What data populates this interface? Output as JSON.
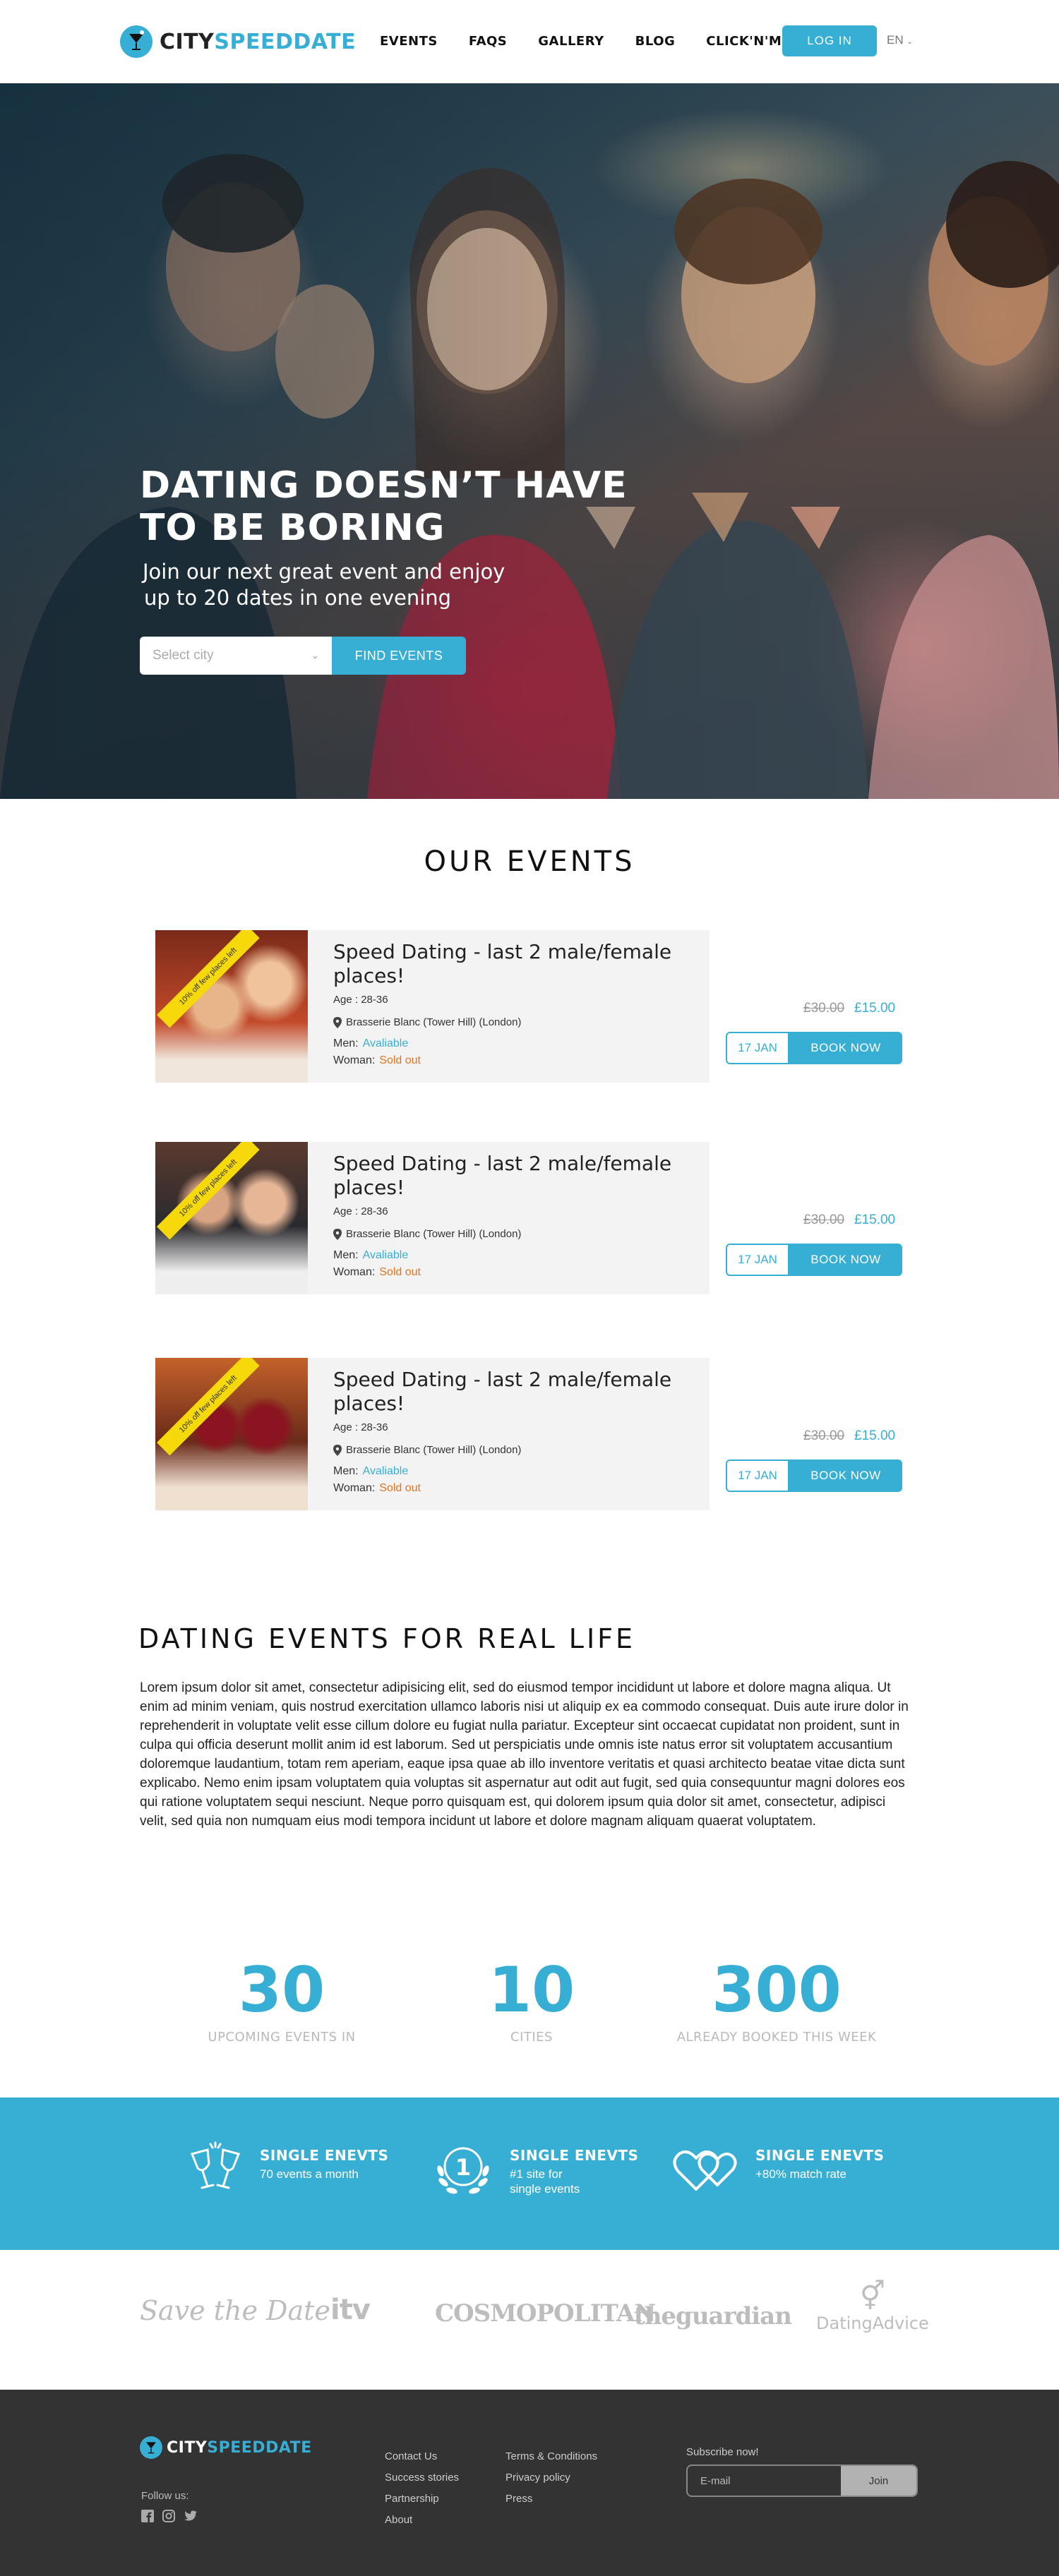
{
  "brand": {
    "name_part1": "CITY",
    "name_part2": "SPEEDDATE",
    "accent": "#37aed3",
    "icon": "cocktail-glass-icon"
  },
  "nav": {
    "items": [
      {
        "label": "EVENTS"
      },
      {
        "label": "FAQS"
      },
      {
        "label": "GALLERY"
      },
      {
        "label": "BLOG"
      },
      {
        "label": "CLICK'N'MEET"
      }
    ]
  },
  "header": {
    "login_label": "LOG IN",
    "language": "EN"
  },
  "hero": {
    "title_line1": "DATING DOESN’T HAVE",
    "title_line2": "TO BE BORING",
    "subtitle_line1": "Join our next great event and enjoy",
    "subtitle_line2": "up to 20 dates in one evening",
    "city_placeholder": "Select city",
    "find_label": "FIND EVENTS"
  },
  "events": {
    "title": "OUR EVENTS",
    "items": [
      {
        "ribbon": "10% off few places left",
        "title": "Speed Dating - last 2 male/female places!",
        "age": "Age : 28-36",
        "venue": "Brasserie Blanc (Tower Hill) (London)",
        "men_label": "Men:",
        "men_status": "Avaliable",
        "women_label": "Woman:",
        "women_status": "Sold out",
        "old_price": "£30.00",
        "new_price": "£15.00",
        "date": "17 JAN",
        "book_label": "BOOK NOW"
      },
      {
        "ribbon": "10% off few places left",
        "title": "Speed Dating - last 2 male/female places!",
        "age": "Age : 28-36",
        "venue": "Brasserie Blanc (Tower Hill) (London)",
        "men_label": "Men:",
        "men_status": "Avaliable",
        "women_label": "Woman:",
        "women_status": "Sold out",
        "old_price": "£30.00",
        "new_price": "£15.00",
        "date": "17 JAN",
        "book_label": "BOOK NOW"
      },
      {
        "ribbon": "10% off few places left",
        "title": "Speed Dating - last 2 male/female places!",
        "age": "Age : 28-36",
        "venue": "Brasserie Blanc (Tower Hill) (London)",
        "men_label": "Men:",
        "men_status": "Avaliable",
        "women_label": "Woman:",
        "women_status": "Sold out",
        "old_price": "£30.00",
        "new_price": "£15.00",
        "date": "17 JAN",
        "book_label": "BOOK NOW"
      }
    ]
  },
  "real_life": {
    "title": "DATING EVENTS FOR REAL LIFE",
    "text": "Lorem ipsum dolor sit amet, consectetur adipisicing elit, sed do eiusmod tempor incididunt ut labore et dolore magna aliqua. Ut enim ad minim veniam, quis nostrud exercitation ullamco laboris nisi ut aliquip ex ea commodo consequat. Duis aute irure dolor in reprehenderit in voluptate velit esse cillum dolore eu fugiat nulla pariatur. Excepteur sint occaecat cupidatat non proident, sunt in culpa qui officia deserunt mollit anim id est laborum. Sed ut perspiciatis unde omnis iste natus error sit voluptatem accusantium doloremque laudantium, totam rem aperiam, eaque ipsa quae ab illo inventore veritatis et quasi architecto beatae vitae dicta sunt explicabo. Nemo enim ipsam voluptatem quia voluptas sit aspernatur aut odit aut fugit, sed quia consequuntur magni dolores eos qui ratione voluptatem sequi nesciunt. Neque porro quisquam est, qui dolorem ipsum quia dolor sit amet, consectetur, adipisci velit, sed quia non numquam eius modi tempora incidunt ut labore et dolore magnam aliquam quaerat voluptatem."
  },
  "stats": [
    {
      "number": "30",
      "label": "UPCOMING EVENTS IN"
    },
    {
      "number": "10",
      "label": "CITIES"
    },
    {
      "number": "300",
      "label": "ALREADY BOOKED THIS WEEK"
    }
  ],
  "features": [
    {
      "icon": "toasting-glasses-icon",
      "title": "SINGLE ENEVTS",
      "line1": "70 events a month",
      "line2": ""
    },
    {
      "icon": "number-one-medal-icon",
      "title": "SINGLE ENEVTS",
      "line1": "#1 site for",
      "line2": "single events"
    },
    {
      "icon": "hearts-icon",
      "title": "SINGLE ENEVTS",
      "line1": "+80% match rate",
      "line2": ""
    }
  ],
  "press": [
    "Save the Date",
    "itv",
    "COSMOPOLITAN",
    "theguardian",
    "DatingAdvice"
  ],
  "footer": {
    "follow_label": "Follow us:",
    "social_icons": [
      "facebook-icon",
      "instagram-icon",
      "twitter-icon"
    ],
    "col1": [
      "Contact Us",
      "Success stories",
      "Partnership",
      "About"
    ],
    "col2": [
      "Terms & Conditions",
      "Privacy policy",
      "Press"
    ],
    "subscribe_label": "Subscribe now!",
    "email_placeholder": "E-mail",
    "join_label": "Join"
  }
}
